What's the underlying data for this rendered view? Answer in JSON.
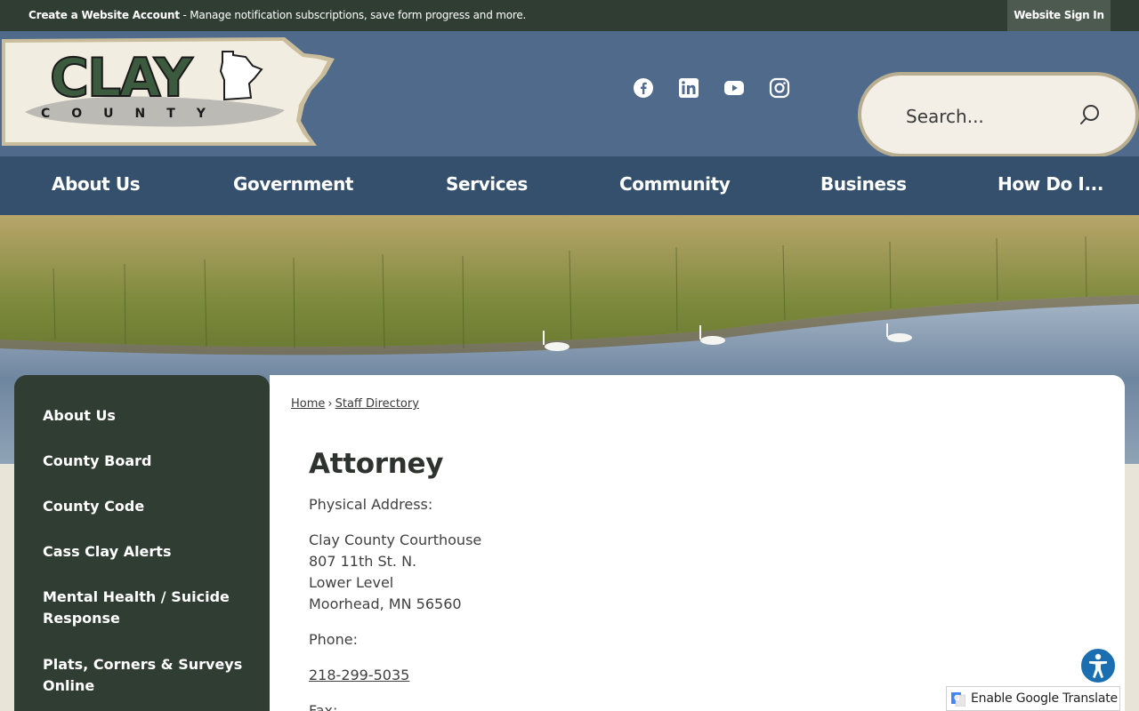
{
  "topbar": {
    "account_link": "Create a Website Account",
    "account_desc": " - Manage notification subscriptions, save form progress and more.",
    "signin": "Website Sign In"
  },
  "logo": {
    "line1": "CLAY",
    "line2": "COUNTY"
  },
  "social": [
    "facebook-icon",
    "linkedin-icon",
    "youtube-icon",
    "instagram-icon"
  ],
  "search": {
    "placeholder": "Search..."
  },
  "nav": [
    "About Us",
    "Government",
    "Services",
    "Community",
    "Business",
    "How Do I..."
  ],
  "sidenav": [
    "About Us",
    "County Board",
    "County Code",
    "Cass Clay Alerts",
    "Mental Health / Suicide Response",
    "Plats, Corners & Surveys Online"
  ],
  "breadcrumb": {
    "home": "Home",
    "sep": "›",
    "current": "Staff Directory"
  },
  "page": {
    "title": "Attorney",
    "physical_label": "Physical Address:",
    "address": [
      "Clay County Courthouse",
      "807 11th St. N.",
      "Lower Level",
      "Moorhead, MN 56560"
    ],
    "phone_label": "Phone:",
    "phone": "218-299-5035",
    "fax_label": "Fax:"
  },
  "translate": {
    "label": "Enable Google Translate"
  },
  "colors": {
    "topbar": "#2f3d33",
    "header": "#4f6a8a",
    "nav": "#34506d",
    "sidenav": "#2f3d33",
    "accent_gold": "#b9ad8f"
  }
}
